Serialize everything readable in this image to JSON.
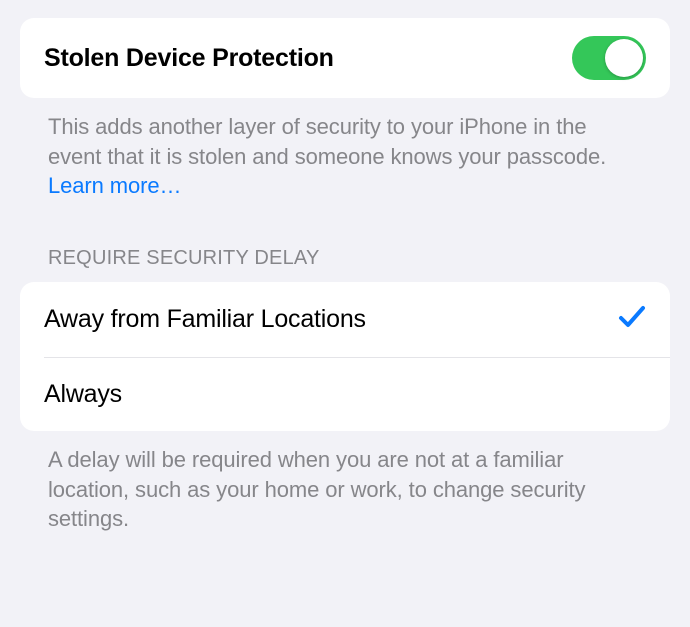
{
  "main": {
    "title": "Stolen Device Protection",
    "toggle_on": true,
    "description_text": "This adds another layer of security to your iPhone in the event that it is stolen and someone knows your passcode. ",
    "learn_more": "Learn more…"
  },
  "delay_section": {
    "header": "REQUIRE SECURITY DELAY",
    "options": [
      {
        "label": "Away from Familiar Locations",
        "selected": true
      },
      {
        "label": "Always",
        "selected": false
      }
    ],
    "footer": "A delay will be required when you are not at a familiar location, such as your home or work, to change security settings."
  }
}
